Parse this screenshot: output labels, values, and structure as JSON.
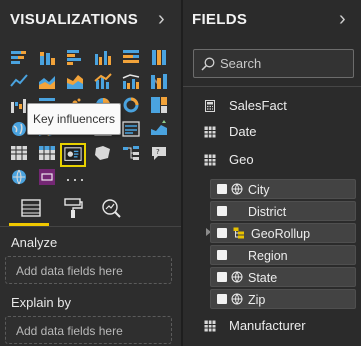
{
  "visualizations": {
    "title": "VISUALIZATIONS",
    "chevron": "›",
    "tooltip": "Key influencers",
    "more": "···",
    "tiles": [
      "stacked-bar-icon",
      "stacked-column-icon",
      "clustered-bar-icon",
      "clustered-column-icon",
      "100-bar-icon",
      "100-column-icon",
      "line-chart-icon",
      "area-chart-icon",
      "stacked-area-icon",
      "line-column-icon",
      "line-clustered-column-icon",
      "ribbon-chart-icon",
      "waterfall-icon",
      "funnel-icon",
      "scatter-icon",
      "pie-icon",
      "donut-icon",
      "treemap-icon",
      "map-icon",
      "filled-map-icon",
      "gauge-icon",
      "card-icon",
      "multirow-card-icon",
      "kpi-icon",
      "table-icon",
      "matrix-icon",
      "key-influencers-icon",
      "shape-map-icon",
      "decomposition-icon",
      "qa-icon",
      "arcgis-map-icon",
      "powerapps-icon"
    ],
    "tabs": [
      "fields-tab-icon",
      "format-paint-roller-icon",
      "analytics-magnifier-icon"
    ],
    "sections": [
      {
        "label": "Analyze",
        "placeholder": "Add data fields here"
      },
      {
        "label": "Explain by",
        "placeholder": "Add data fields here"
      }
    ],
    "accent": "#f0c800",
    "selected_border": "#e8d100"
  },
  "fields": {
    "title": "FIELDS",
    "chevron": "›",
    "search_placeholder": "Search",
    "tables": [
      {
        "name": "SalesFact",
        "icon": "calculator-icon"
      },
      {
        "name": "Date",
        "icon": "table-icon"
      },
      {
        "name": "Geo",
        "icon": "table-icon"
      },
      {
        "name": "Manufacturer",
        "icon": "table-icon"
      }
    ],
    "geo_fields": [
      {
        "name": "City",
        "globe": true
      },
      {
        "name": "District",
        "globe": false
      },
      {
        "name": "GeoRollup",
        "hierarchy": true
      },
      {
        "name": "Region",
        "globe": false
      },
      {
        "name": "State",
        "globe": true
      },
      {
        "name": "Zip",
        "globe": true
      }
    ]
  }
}
